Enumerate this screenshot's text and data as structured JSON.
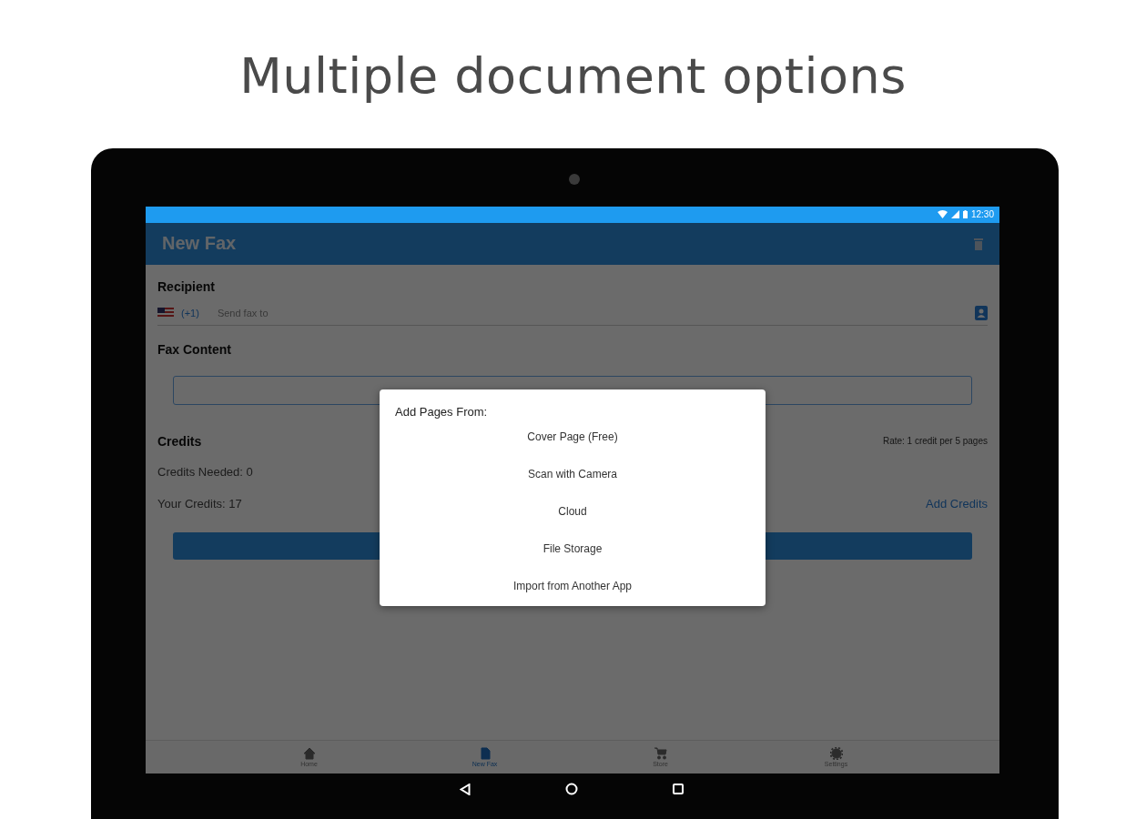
{
  "headline": "Multiple document options",
  "status_bar": {
    "time": "12:30"
  },
  "app_bar": {
    "title": "New Fax"
  },
  "recipient": {
    "label": "Recipient",
    "country_code": "(+1)",
    "placeholder": "Send fax to"
  },
  "fax_content": {
    "label": "Fax Content"
  },
  "credits": {
    "label": "Credits",
    "rate": "Rate: 1 credit per 5 pages",
    "needed": "Credits Needed: 0",
    "yours": "Your Credits: 17",
    "add_link": "Add Credits"
  },
  "dialog": {
    "title": "Add Pages From:",
    "options": [
      "Cover Page (Free)",
      "Scan with Camera",
      "Cloud",
      "File Storage",
      "Import from Another App"
    ]
  },
  "bottom_nav": [
    {
      "kind": "home",
      "label": "Home",
      "selected": false
    },
    {
      "kind": "fax",
      "label": "New Fax",
      "selected": true
    },
    {
      "kind": "store",
      "label": "Store",
      "selected": false
    },
    {
      "kind": "settings",
      "label": "Settings",
      "selected": false
    }
  ]
}
